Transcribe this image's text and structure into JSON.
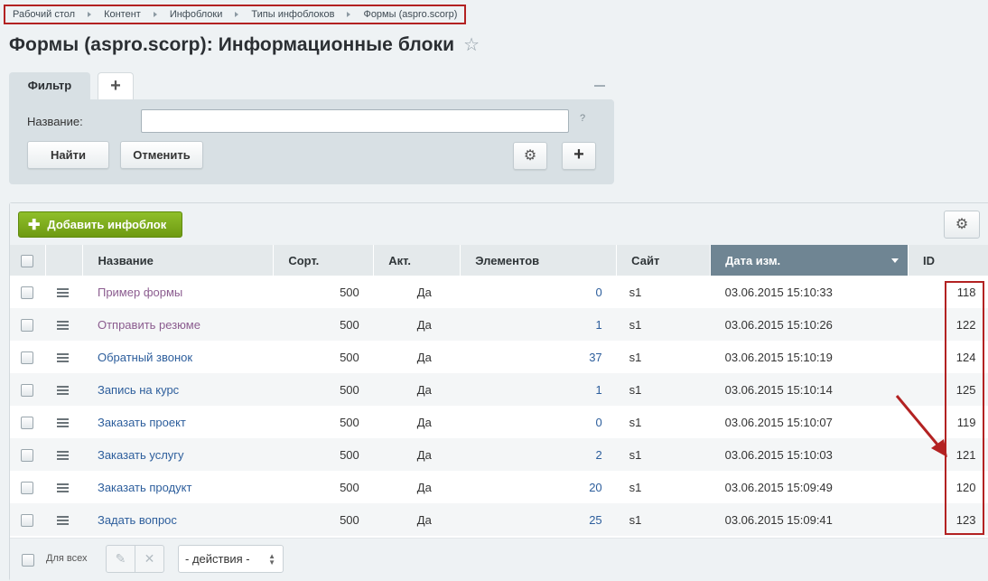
{
  "breadcrumb": [
    "Рабочий стол",
    "Контент",
    "Инфоблоки",
    "Типы инфоблоков",
    "Формы (aspro.scorp)"
  ],
  "page_title": "Формы (aspro.scorp): Информационные блоки",
  "filter": {
    "tab_label": "Фильтр",
    "add_tab_label": "+",
    "name_label": "Название:",
    "name_value": "",
    "help": "?",
    "find_button": "Найти",
    "cancel_button": "Отменить",
    "plus_button": "+"
  },
  "toolbar": {
    "add_button": "Добавить инфоблок"
  },
  "table": {
    "columns": [
      "Название",
      "Сорт.",
      "Акт.",
      "Элементов",
      "Сайт",
      "Дата изм.",
      "ID"
    ],
    "sorted_column": "Дата изм.",
    "rows": [
      {
        "name": "Пример формы",
        "sort": "500",
        "active": "Да",
        "elements": "0",
        "site": "s1",
        "date": "03.06.2015 15:10:33",
        "id": "118"
      },
      {
        "name": "Отправить резюме",
        "sort": "500",
        "active": "Да",
        "elements": "1",
        "site": "s1",
        "date": "03.06.2015 15:10:26",
        "id": "122"
      },
      {
        "name": "Обратный звонок",
        "sort": "500",
        "active": "Да",
        "elements": "37",
        "site": "s1",
        "date": "03.06.2015 15:10:19",
        "id": "124"
      },
      {
        "name": "Запись на курс",
        "sort": "500",
        "active": "Да",
        "elements": "1",
        "site": "s1",
        "date": "03.06.2015 15:10:14",
        "id": "125"
      },
      {
        "name": "Заказать проект",
        "sort": "500",
        "active": "Да",
        "elements": "0",
        "site": "s1",
        "date": "03.06.2015 15:10:07",
        "id": "119"
      },
      {
        "name": "Заказать услугу",
        "sort": "500",
        "active": "Да",
        "elements": "2",
        "site": "s1",
        "date": "03.06.2015 15:10:03",
        "id": "121"
      },
      {
        "name": "Заказать продукт",
        "sort": "500",
        "active": "Да",
        "elements": "20",
        "site": "s1",
        "date": "03.06.2015 15:09:49",
        "id": "120"
      },
      {
        "name": "Задать вопрос",
        "sort": "500",
        "active": "Да",
        "elements": "25",
        "site": "s1",
        "date": "03.06.2015 15:09:41",
        "id": "123"
      }
    ]
  },
  "footer": {
    "for_all_label": "Для всех",
    "actions_select": "- действия -"
  },
  "colors": {
    "accent_green": "#7aab1b",
    "highlight_red": "#b32222",
    "sorted_header": "#6f8593"
  }
}
